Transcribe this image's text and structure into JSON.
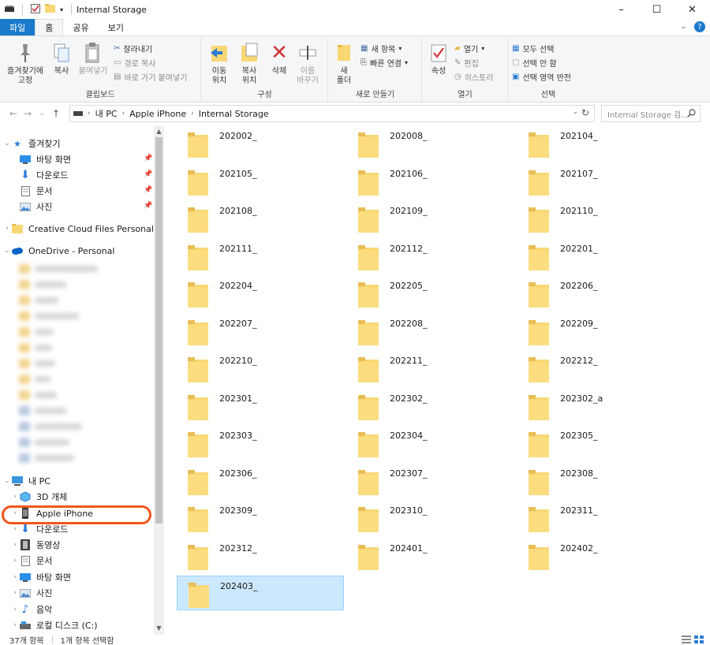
{
  "window": {
    "title": "Internal Storage",
    "controls": [
      "–",
      "☐",
      "✕"
    ]
  },
  "ribbon_tabs": {
    "file": "파일",
    "home": "홈",
    "share": "공유",
    "view": "보기"
  },
  "ribbon": {
    "clipboard": {
      "pin": "즐겨찾기에\n고정",
      "copy": "복사",
      "paste": "붙여넣기",
      "cut": "잘라내기",
      "copy_path": "경로 복사",
      "paste_shortcut": "바로 가기 붙여넣기",
      "label": "클립보드"
    },
    "organize": {
      "move_to": "이동\n위치",
      "copy_to": "복사\n위치",
      "delete": "삭제",
      "rename": "이름\n바꾸기",
      "label": "구성"
    },
    "new": {
      "new_folder": "새\n폴더",
      "new_item": "새 항목",
      "easy_access": "빠른 연결",
      "label": "새로 만들기"
    },
    "open": {
      "properties": "속성",
      "open": "열기",
      "edit": "편집",
      "history": "히스토리",
      "label": "열기"
    },
    "select": {
      "select_all": "모두 선택",
      "select_none": "선택 안 함",
      "invert": "선택 영역 반전",
      "label": "선택"
    }
  },
  "address": {
    "crumbs": [
      "내 PC",
      "Apple iPhone",
      "Internal Storage"
    ],
    "search_placeholder": "Internal Storage 검..."
  },
  "nav": {
    "quick_access": "즐겨찾기",
    "desktop": "바탕 화면",
    "downloads": "다운로드",
    "documents": "문서",
    "pictures": "사진",
    "creative_cloud": "Creative Cloud Files Personal Acco",
    "onedrive": "OneDrive - Personal",
    "this_pc": "내 PC",
    "objects3d": "3D 개체",
    "iphone": "Apple iPhone",
    "pc_downloads": "다운로드",
    "videos": "동영상",
    "pc_documents": "문서",
    "pc_desktop": "바탕 화면",
    "pc_pictures": "사진",
    "music": "음악",
    "local_disk": "로컬 디스크 (C:)"
  },
  "folders": [
    "202002_",
    "202008_",
    "202104_",
    "202105_",
    "202106_",
    "202107_",
    "202108_",
    "202109_",
    "202110_",
    "202111_",
    "202112_",
    "202201_",
    "202204_",
    "202205_",
    "202206_",
    "202207_",
    "202208_",
    "202209_",
    "202210_",
    "202211_",
    "202212_",
    "202301_",
    "202302_",
    "202302_a",
    "202303_",
    "202304_",
    "202305_",
    "202306_",
    "202307_",
    "202308_",
    "202309_",
    "202310_",
    "202311_",
    "202312_",
    "202401_",
    "202402_",
    "202403_"
  ],
  "selected_folder": "202403_",
  "status": {
    "count": "37개 항목",
    "selected": "1개 항목 선택함"
  },
  "colors": {
    "accent": "#1979ca",
    "highlight_ring": "#f0561e",
    "selection": "#cce8ff",
    "folder": "#f8d775"
  }
}
